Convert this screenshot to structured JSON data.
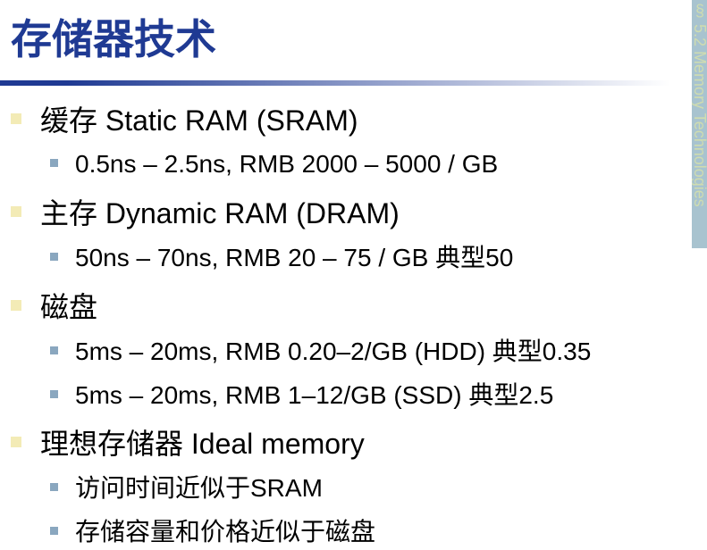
{
  "slide": {
    "title": "存储器技术",
    "side_banner": "§ 5.2 Memory Technologies"
  },
  "colors": {
    "title": "#1f3a93",
    "side_banner_bg": "#a8c3cf",
    "side_banner_text": "#cfdcb0",
    "rule_start": "#1f3a93",
    "rule_end": "#ffffff",
    "level1_bullet": "#f3ebb6",
    "level2_bullet": "#8aa7bf"
  },
  "bullets": [
    {
      "level": 1,
      "text": "缓存 Static RAM (SRAM)"
    },
    {
      "level": 2,
      "text": "0.5ns – 2.5ns, RMB 2000 – 5000 / GB"
    },
    {
      "level": 1,
      "text": "主存 Dynamic RAM (DRAM)"
    },
    {
      "level": 2,
      "text": "50ns – 70ns,  RMB 20 – 75 / GB 典型50"
    },
    {
      "level": 1,
      "text": "磁盘"
    },
    {
      "level": 2,
      "text": "5ms – 20ms, RMB 0.20–2/GB (HDD) 典型0.35"
    },
    {
      "level": 2,
      "text": "5ms – 20ms, RMB 1–12/GB (SSD) 典型2.5"
    },
    {
      "level": 1,
      "text": "理想存储器 Ideal memory"
    },
    {
      "level": 2,
      "text": "访问时间近似于SRAM"
    },
    {
      "level": 2,
      "text": "存储容量和价格近似于磁盘"
    }
  ]
}
